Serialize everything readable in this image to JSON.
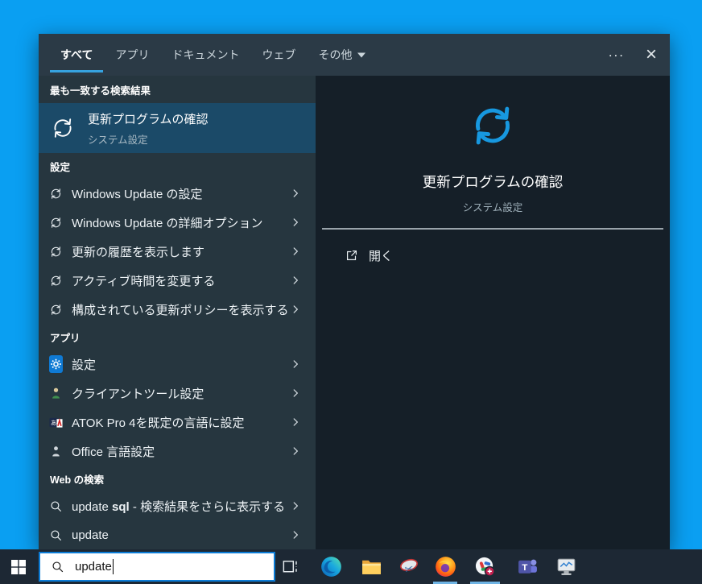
{
  "colors": {
    "desktop_blue": "#0a9ff2",
    "accent_blue": "#1798e0",
    "tab_underline": "#36a3e0",
    "best_match_bg": "#1b4a68",
    "search_border": "#0c7cd6",
    "taskbar_bg": "#1d2834"
  },
  "window": {
    "tabs": [
      {
        "id": "all",
        "label": "すべて",
        "active": true
      },
      {
        "id": "apps",
        "label": "アプリ"
      },
      {
        "id": "documents",
        "label": "ドキュメント"
      },
      {
        "id": "web",
        "label": "ウェブ"
      },
      {
        "id": "others",
        "label": "その他",
        "caret": true
      }
    ],
    "more_label": "...",
    "close_label": "×"
  },
  "results": {
    "best_match": {
      "header": "最も一致する検索結果",
      "title": "更新プログラムの確認",
      "subtitle": "システム設定",
      "icon": "refresh-icon"
    },
    "sections": [
      {
        "id": "settings",
        "header": "設定",
        "items": [
          {
            "label": "Windows Update の設定",
            "icon": "refresh-icon"
          },
          {
            "label": "Windows Update の詳細オプション",
            "icon": "refresh-icon"
          },
          {
            "label": "更新の履歴を表示します",
            "icon": "refresh-icon"
          },
          {
            "label": "アクティブ時間を変更する",
            "icon": "refresh-icon"
          },
          {
            "label": "構成されている更新ポリシーを表示する",
            "icon": "refresh-icon"
          }
        ]
      },
      {
        "id": "apps",
        "header": "アプリ",
        "items": [
          {
            "label": "設定",
            "icon": "settings-gear-icon"
          },
          {
            "label": "クライアントツール設定",
            "icon": "client-tools-icon"
          },
          {
            "label": "ATOK Pro 4を既定の言語に設定",
            "icon": "atok-icon"
          },
          {
            "label": "Office 言語設定",
            "icon": "office-icon"
          }
        ]
      },
      {
        "id": "web-search",
        "header": "Web の検索",
        "items": [
          {
            "parts": {
              "prefix": "update ",
              "bold": "sql",
              "suffix": " - 検索結果をさらに表示する"
            },
            "icon": "search-icon"
          },
          {
            "label": "update",
            "icon": "search-icon"
          }
        ]
      }
    ]
  },
  "preview": {
    "icon": "refresh-icon",
    "title": "更新プログラムの確認",
    "subtitle": "システム設定",
    "action_label": "開く",
    "action_icon": "open-external-icon"
  },
  "taskbar": {
    "search_value": "update",
    "icons": [
      {
        "name": "edge-icon"
      },
      {
        "name": "file-explorer-icon"
      },
      {
        "name": "snipping-tool-icon"
      },
      {
        "name": "firefox-icon",
        "indicator": true
      },
      {
        "name": "app-badge-icon",
        "indicator": true,
        "indicator_wide": true
      },
      {
        "name": "teams-icon"
      },
      {
        "name": "system-monitor-icon"
      }
    ]
  }
}
